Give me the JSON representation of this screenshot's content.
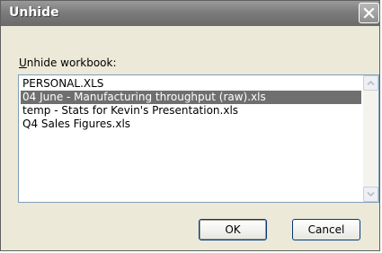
{
  "window": {
    "title": "Unhide"
  },
  "label": {
    "mnemonic": "U",
    "rest": "nhide workbook:"
  },
  "workbooks": [
    {
      "name": "PERSONAL.XLS",
      "selected": false
    },
    {
      "name": "04 June - Manufacturing throughput (raw).xls",
      "selected": true
    },
    {
      "name": "temp - Stats for Kevin's Presentation.xls",
      "selected": false
    },
    {
      "name": "Q4 Sales Figures.xls",
      "selected": false
    }
  ],
  "buttons": {
    "ok": "OK",
    "cancel": "Cancel"
  },
  "icons": {
    "close": "close-icon",
    "scroll_up": "chevron-up-icon",
    "scroll_down": "chevron-down-icon"
  }
}
